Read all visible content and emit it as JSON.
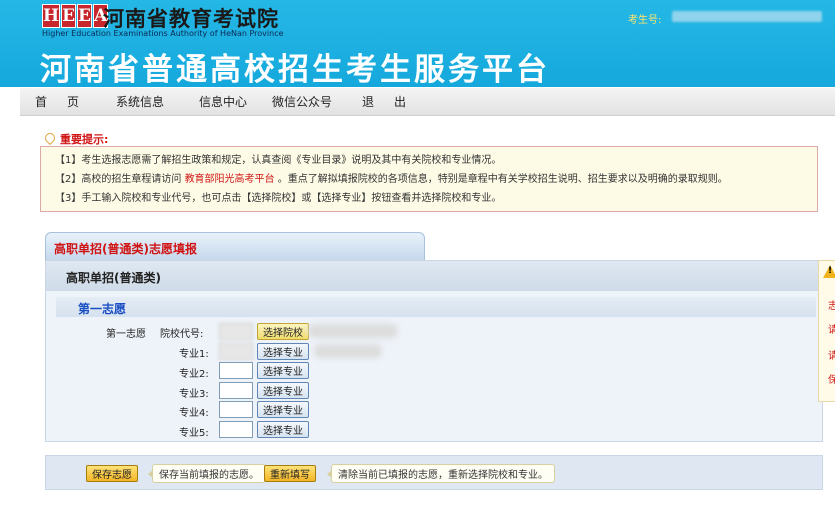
{
  "header": {
    "logo_letters": [
      "H",
      "E",
      "E",
      "A"
    ],
    "org_name_cn": "河南省教育考试院",
    "org_name_en_line1": "Higher Education Examinations Authority of HeNan Province",
    "org_name_en_line2": "",
    "platform_title": "河南省普通高校招生考生服务平台",
    "examinee_label": "考生号:"
  },
  "nav": {
    "home": "首页",
    "system_info": "系统信息",
    "info_center": "信息中心",
    "wechat": "微信公众号",
    "exit": "退出"
  },
  "notice": {
    "title": "重要提示:",
    "line1": "【1】考生选报志愿需了解招生政策和规定，认真查阅《专业目录》说明及其中有关院校和专业情况。",
    "line2_pre": "【2】高校的招生章程请访问",
    "line2_link": "教育部阳光高考平台",
    "line2_post": "。重点了解拟填报院校的各项信息，特别是章程中有关学校招生说明、招生要求以及明确的录取规则。",
    "line3": "【3】手工输入院校和专业代号，也可点击【选择院校】或【选择专业】按钮查看并选择院校和专业。"
  },
  "form": {
    "tab_title": "高职单招(普通类)志愿填报",
    "panel_title": "高职单招(普通类)",
    "section_title": "第一志愿",
    "choice_label": "第一志愿",
    "school_code_label": "院校代号:",
    "select_school": "选择院校",
    "select_major": "选择专业",
    "majors": [
      {
        "label": "专业1:"
      },
      {
        "label": "专业2:"
      },
      {
        "label": "专业3:"
      },
      {
        "label": "专业4:"
      },
      {
        "label": "专业5:"
      }
    ]
  },
  "actions": {
    "save": "保存志愿",
    "save_hint": "保存当前填报的志愿。",
    "reset": "重新填写",
    "reset_hint": "清除当前已填报的志愿，重新选择院校和专业。"
  },
  "side_panel": {
    "chars": [
      "志",
      "请",
      "请",
      "保"
    ]
  },
  "colors": {
    "header_bg": "#1fb2e2",
    "accent_red": "#d01515",
    "section_blue": "#1a4fc4",
    "action_yellow": "#f3b526"
  }
}
